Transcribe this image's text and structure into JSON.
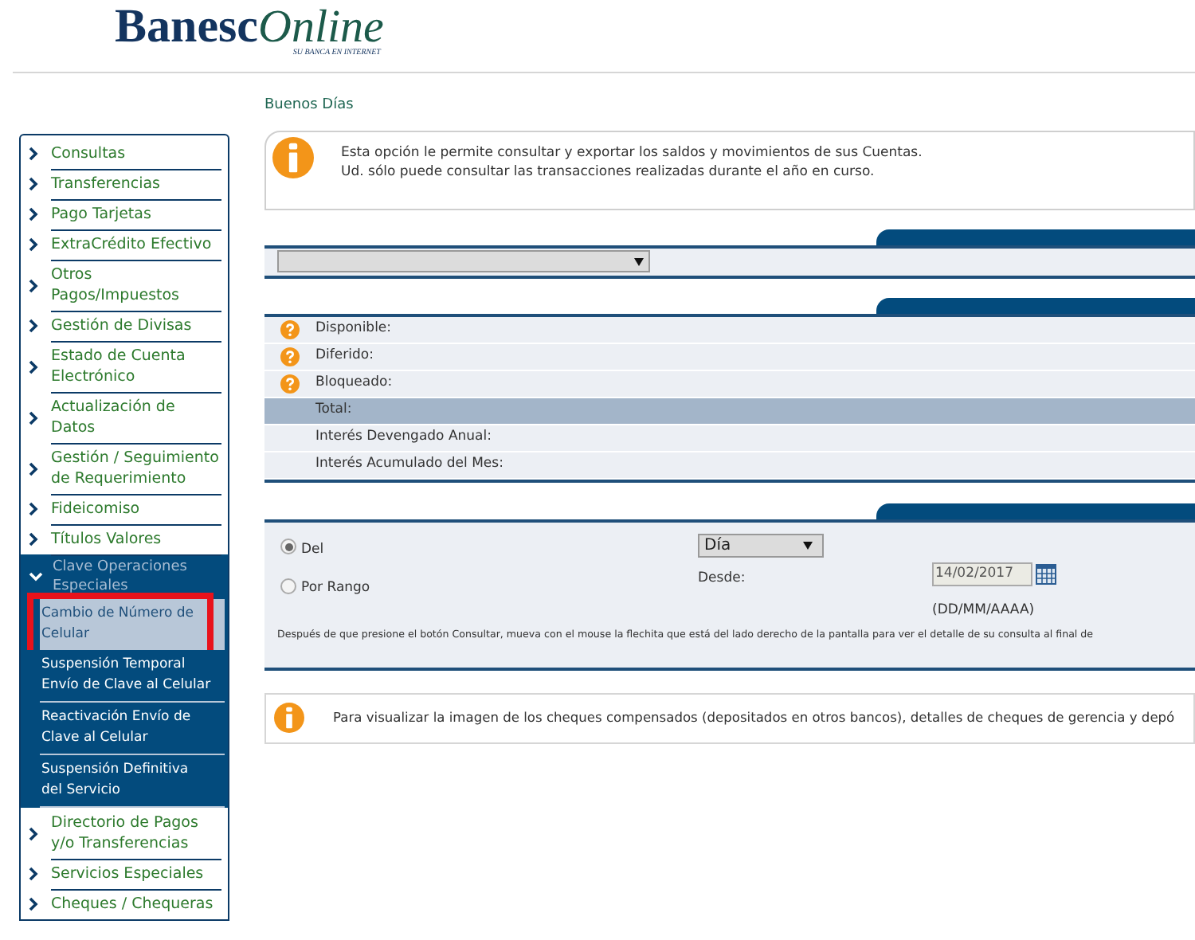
{
  "header": {
    "logo_bold": "Banesc",
    "logo_italic": "Online",
    "tagline": "SU BANCA EN INTERNET"
  },
  "sidebar": {
    "items": [
      {
        "label": "Consultas",
        "expanded": false
      },
      {
        "label": "Transferencias",
        "expanded": false
      },
      {
        "label": "Pago Tarjetas",
        "expanded": false
      },
      {
        "label": "ExtraCrédito Efectivo",
        "expanded": false
      },
      {
        "label": "Otros\nPagos/Impuestos",
        "expanded": false
      },
      {
        "label": "Gestión de Divisas",
        "expanded": false
      },
      {
        "label": "Estado de Cuenta\nElectrónico",
        "expanded": false
      },
      {
        "label": "Actualización de Datos",
        "expanded": false
      },
      {
        "label": "Gestión / Seguimiento\nde Requerimiento",
        "expanded": false
      },
      {
        "label": "Fideicomiso",
        "expanded": false
      },
      {
        "label": "Títulos Valores",
        "expanded": false
      },
      {
        "label": "Clave Operaciones\nEspeciales",
        "expanded": true,
        "children": [
          {
            "label": "Cambio de Número de\nCelular",
            "selected": true,
            "highlighted": true
          },
          {
            "label": "Suspensión Temporal\nEnvío de Clave al Celular",
            "selected": false,
            "highlighted": false
          },
          {
            "label": "Reactivación Envío de\nClave al Celular",
            "selected": false,
            "highlighted": false
          },
          {
            "label": "Suspensión Definitiva\ndel Servicio",
            "selected": false,
            "highlighted": false
          }
        ]
      },
      {
        "label": "Directorio de Pagos\ny/o Transferencias",
        "expanded": false
      },
      {
        "label": "Servicios Especiales",
        "expanded": false
      },
      {
        "label": "Cheques / Chequeras",
        "expanded": false
      }
    ]
  },
  "greeting": "Buenos Días",
  "info": {
    "lines": [
      "Esta opción le permite consultar y exportar los saldos y movimientos de sus Cuentas.",
      "Ud. sólo puede consultar las transacciones realizadas durante el año en curso."
    ]
  },
  "balances": [
    {
      "label": "Disponible:",
      "kind": "help"
    },
    {
      "label": "Diferido:",
      "kind": "help"
    },
    {
      "label": "Bloqueado:",
      "kind": "help"
    },
    {
      "label": "Total:",
      "kind": "total"
    },
    {
      "label": "Interés Devengado Anual:",
      "kind": "plain"
    },
    {
      "label": "Interés Acumulado del Mes:",
      "kind": "plain"
    }
  ],
  "period": {
    "options": [
      {
        "label": "Del",
        "selected": true
      },
      {
        "label": "Por Rango",
        "selected": false
      }
    ],
    "unit": "Día",
    "from_label": "Desde:",
    "from_value": "14/02/2017",
    "format": "(DD/MM/AAAA)",
    "note": "Después de que presione el botón Consultar, mueva con el mouse la flechita que está del lado derecho de la pantalla para ver el detalle de su consulta al final de"
  },
  "footer_info": "Para visualizar la imagen de los cheques compensados (depositados en otros bancos), detalles de cheques de gerencia y depó"
}
